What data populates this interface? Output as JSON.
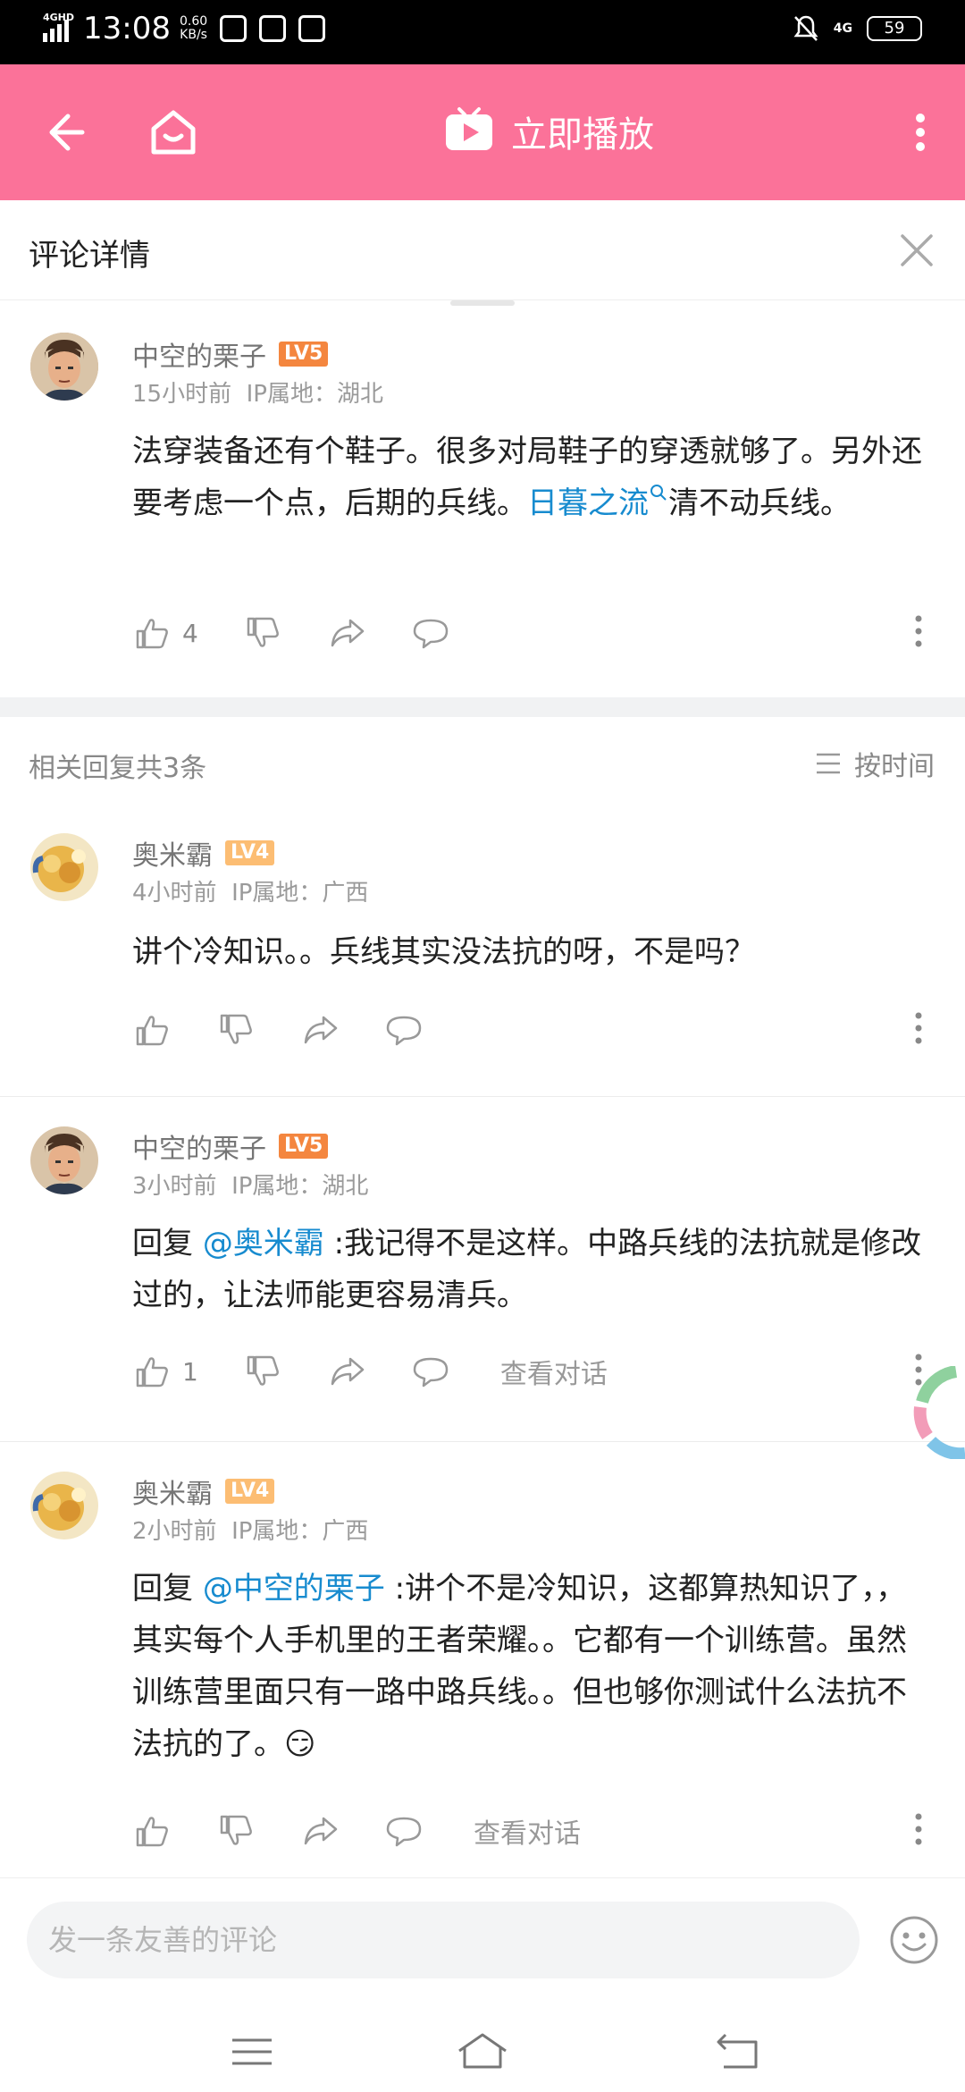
{
  "status_bar": {
    "network": "4GHD",
    "time": "13:08",
    "speed_value": "0.60",
    "speed_unit": "KB/s",
    "network_right": "4G",
    "battery": "59"
  },
  "topbar": {
    "play_label": "立即播放",
    "accent": "#fb7299"
  },
  "sheet": {
    "title": "评论详情"
  },
  "main_comment": {
    "user": "中空的栗子",
    "level": "LV5",
    "level_color": "#f4863f",
    "time": "15小时前",
    "ip": "IP属地：湖北",
    "text_1": "法穿装备还有个鞋子。很多对局鞋子的穿透就够了。另外还要考虑一个点，后期的兵线。",
    "link": "日暮之流",
    "text_2": "清不动兵线。",
    "likes": "4"
  },
  "replies": {
    "count_label": "相关回复共3条",
    "sort_label": "按时间",
    "items": [
      {
        "user": "奥米霸",
        "level": "LV4",
        "level_color": "#fcbd73",
        "time": "4小时前",
        "ip": "IP属地：广西",
        "text": "讲个冷知识。。兵线其实没法抗的呀，不是吗？"
      },
      {
        "user": "中空的栗子",
        "level": "LV5",
        "level_color": "#f4863f",
        "time": "3小时前",
        "ip": "IP属地：湖北",
        "reply_prefix": "回复 ",
        "mention": "@奥米霸",
        "text": " :我记得不是这样。中路兵线的法抗就是修改过的，让法师能更容易清兵。",
        "likes": "1",
        "view_talk": "查看对话"
      },
      {
        "user": "奥米霸",
        "level": "LV4",
        "level_color": "#fcbd73",
        "time": "2小时前",
        "ip": "IP属地：广西",
        "reply_prefix": "回复 ",
        "mention": "@中空的栗子",
        "text": " :讲个不是冷知识，这都算热知识了，，其实每个人手机里的王者荣耀。。它都有一个训练营。虽然训练营里面只有一路中路兵线。。但也够你测试什么法抗不法抗的了。😏",
        "view_talk": "查看对话"
      }
    ]
  },
  "input": {
    "placeholder": "发一条友善的评论"
  }
}
